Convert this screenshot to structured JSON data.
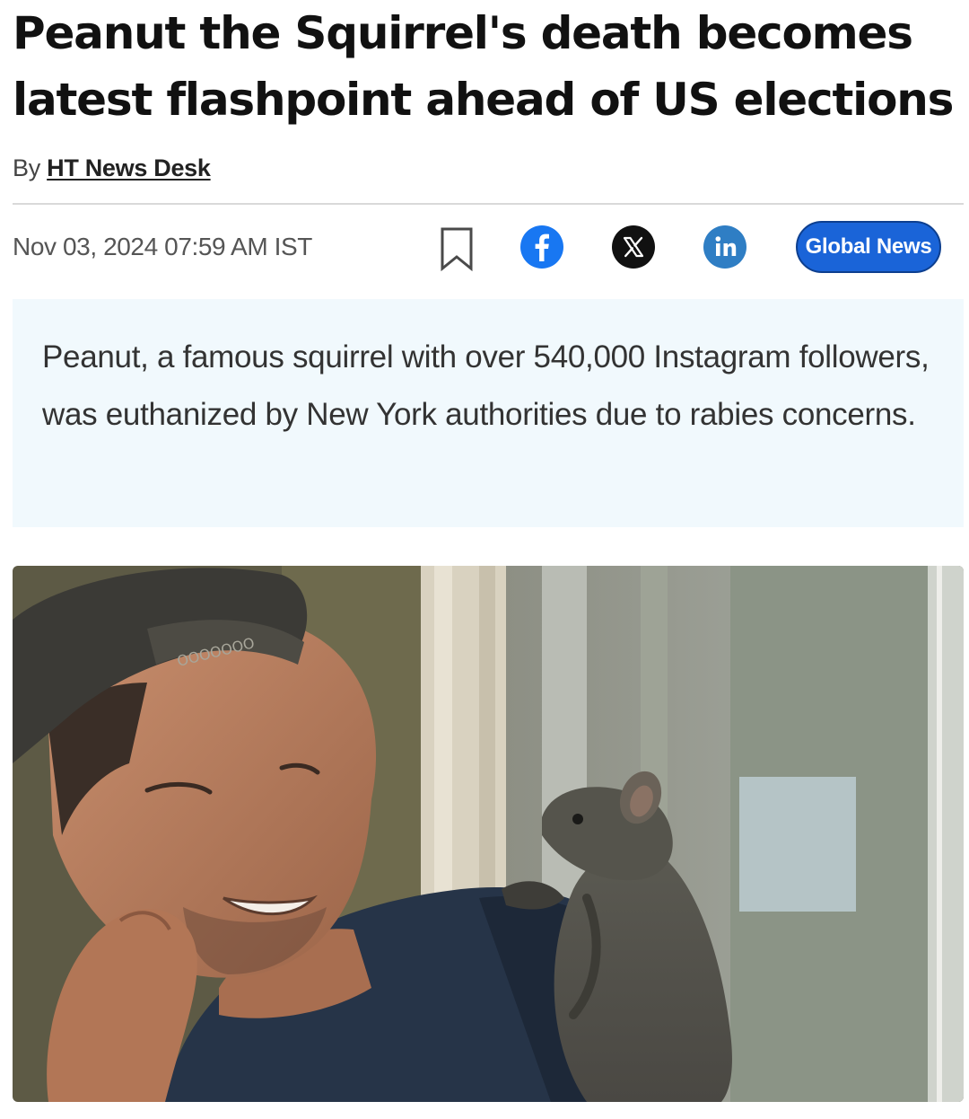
{
  "article": {
    "headline": "Peanut the Squirrel's death becomes latest flashpoint ahead of US elections",
    "byline_prefix": "By",
    "author": "HT News Desk",
    "timestamp": "Nov 03, 2024 07:59 AM IST",
    "summary": "Peanut, a famous squirrel with over 540,000 Instagram followers, was euthanized by New York authorities due to rabies concerns."
  },
  "share": {
    "bookmark_icon": "bookmark-icon",
    "facebook_icon": "facebook-icon",
    "x_icon": "x-icon",
    "linkedin_icon": "linkedin-icon",
    "pill_label": "Global News"
  },
  "colors": {
    "facebook": "#1877f2",
    "x": "#111111",
    "linkedin": "#2f7ec4",
    "pill": "#1a64d8",
    "summary_bg": "#f1f9fd"
  },
  "image": {
    "subject": "photo-man-with-squirrel-on-shoulder",
    "cap_text": "OOOOOOO"
  }
}
